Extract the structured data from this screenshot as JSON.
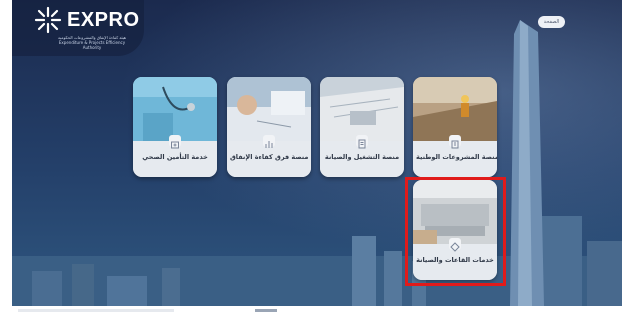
{
  "header": {
    "logo_text": "EXPRO",
    "logo_subtitle": "هيئة كفاءة الإنفاق والمشروعات الحكومية Expenditure & Projects Efficiency Authority",
    "home_button_label": "الصفحة"
  },
  "cards": [
    {
      "label": "منصة المشروعات الوطنية",
      "icon": "building-icon"
    },
    {
      "label": "منصة التشغيل والصيانة",
      "icon": "document-icon"
    },
    {
      "label": "منصة فرق كفاءة الإنفاق",
      "icon": "chart-icon"
    },
    {
      "label": "خدمة التأمين الصحي",
      "icon": "medical-icon"
    },
    {
      "label": "خدمات القاعات والصيانة",
      "icon": "diamond-icon"
    }
  ],
  "colors": {
    "highlight": "#e01b1b",
    "background": "#1b2a4e"
  }
}
